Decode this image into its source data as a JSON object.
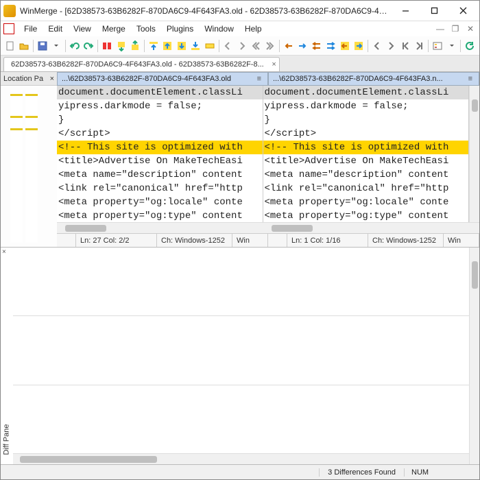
{
  "window": {
    "title": "WinMerge - [62D38573-63B6282F-870DA6C9-4F643FA3.old - 62D38573-63B6282F-870DA6C9-4F643..."
  },
  "menus": [
    "File",
    "Edit",
    "View",
    "Merge",
    "Tools",
    "Plugins",
    "Window",
    "Help"
  ],
  "tab": {
    "label": "62D38573-63B6282F-870DA6C9-4F643FA3.old - 62D38573-63B6282F-8...",
    "close": "×"
  },
  "location": {
    "header": "Location Pa",
    "close": "×"
  },
  "pane_left": {
    "header": "...\\62D38573-63B6282F-870DA6C9-4F643FA3.old",
    "header_eq": "≡"
  },
  "pane_right": {
    "header": "...\\62D38573-63B6282F-870DA6C9-4F643FA3.n..."
  },
  "code_lines": [
    "document.documentElement.classLi",
    "yipress.darkmode = false;",
    "}",
    "</script​>",
    "<!-- This site is optimized with",
    "<title>Advertise On MakeTechEasi",
    "<meta name=\"description\" content",
    "<link rel=\"canonical\" href=\"http",
    "<meta property=\"og:locale\" conte",
    "<meta property=\"og:type\" content"
  ],
  "code_lines_right_overrides": {
    "2": "}",
    "4": "<!-- This site is optimized with"
  },
  "status_left": {
    "lncol": "Ln: 27  Col: 2/2",
    "ch": "Ch: Windows-1252",
    "enc": "Win"
  },
  "status_right": {
    "lncol": "Ln: 1  Col: 1/16",
    "ch": "Ch: Windows-1252",
    "enc": "Win"
  },
  "diff": {
    "label": "Diff Pane",
    "close": "×"
  },
  "bottom_status": {
    "diffs": "3 Differences Found",
    "num": "NUM"
  }
}
